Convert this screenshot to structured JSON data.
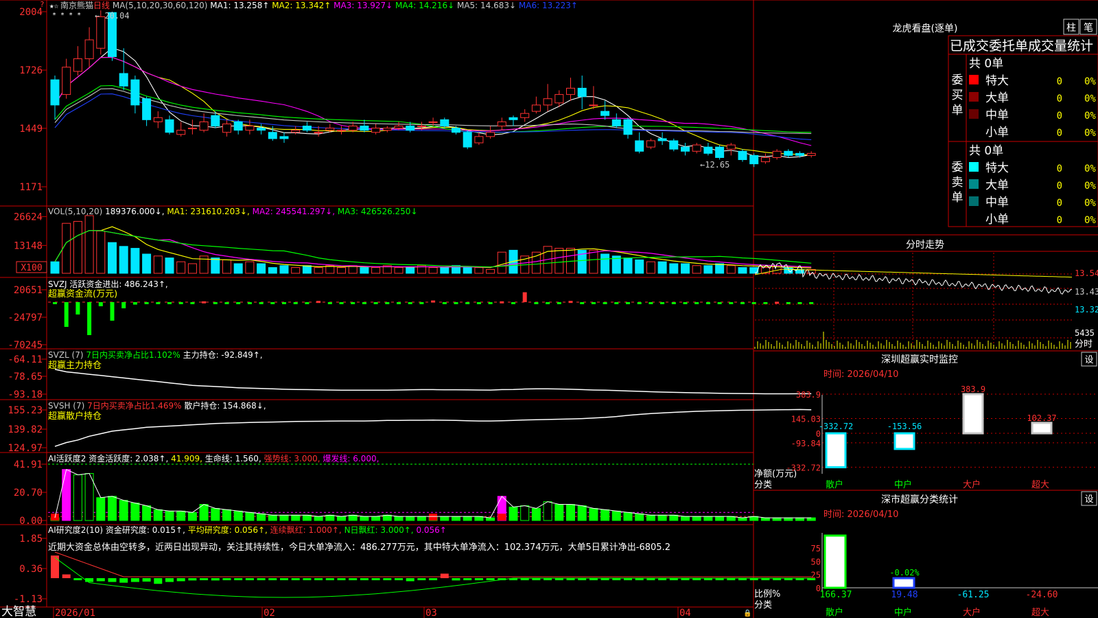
{
  "stock": {
    "name": "南京熊猫",
    "period": "日线"
  },
  "colors": {
    "up": "#ff3232",
    "down": "#00e6ff",
    "grid": "#c80000",
    "volGreen": "#00ff00"
  },
  "main": {
    "legend_prefix": "MA(5,10,20,30,60,120)",
    "ma": [
      {
        "label": "MA1:",
        "value": "13.258",
        "arrow": "↑",
        "color": "#ffffff"
      },
      {
        "label": "MA2:",
        "value": "13.342",
        "arrow": "↑",
        "color": "#ffff00"
      },
      {
        "label": "MA3:",
        "value": "13.927",
        "arrow": "↓",
        "color": "#ff00ff"
      },
      {
        "label": "MA4:",
        "value": "14.216",
        "arrow": "↓",
        "color": "#00ff00"
      },
      {
        "label": "MA5:",
        "value": "14.683",
        "arrow": "↓",
        "color": "#c8c8c8"
      },
      {
        "label": "MA6:",
        "value": "13.223",
        "arrow": "↑",
        "color": "#2040ff"
      }
    ],
    "yticks": [
      "2004",
      "1726",
      "1449",
      "1171"
    ],
    "high_note": "20.04",
    "low_note": "12.65"
  },
  "vol": {
    "legend": [
      {
        "text": "VOL(5,10,20) ",
        "color": "#c8c8c8"
      },
      {
        "text": "189376.000↓, ",
        "color": "#ffffff"
      },
      {
        "text": "MA1: 231610.203↓, ",
        "color": "#ffff00"
      },
      {
        "text": "MA2: 245541.297↓, ",
        "color": "#ff00ff"
      },
      {
        "text": "MA3: 426526.250↓",
        "color": "#00ff00"
      }
    ],
    "yticks": [
      "26624",
      "13148"
    ],
    "unit": "X100"
  },
  "svzj": {
    "legend": [
      {
        "text": "SVZJ  活跃资金进出: 486.243↑,",
        "color": "#ffffff"
      }
    ],
    "sub": "超赢资金流(万元)",
    "yticks": [
      "20651",
      "-24797",
      "-70245"
    ]
  },
  "svzl": {
    "legend": [
      {
        "text": "SVZL (7) ",
        "color": "#c8c8c8"
      },
      {
        "text": "7日内买卖净占比1.102% ",
        "color": "#00ff00"
      },
      {
        "text": "主力持仓: -92.849↑,",
        "color": "#ffffff"
      }
    ],
    "sub": "超赢主力持仓",
    "yticks": [
      "-64.11",
      "-78.65",
      "-93.18"
    ]
  },
  "svsh": {
    "legend": [
      {
        "text": "SVSH (7) ",
        "color": "#c8c8c8"
      },
      {
        "text": "7日内买卖净占比1.469% ",
        "color": "#ff3232"
      },
      {
        "text": "散户持仓: 154.868↓,",
        "color": "#ffffff"
      }
    ],
    "sub": "超赢散户持仓",
    "yticks": [
      "155.23",
      "139.82",
      "124.97"
    ]
  },
  "ai1": {
    "legend": [
      {
        "text": "AI活跃度2 ",
        "color": "#ffffff"
      },
      {
        "text": "资金活跃度: 2.038↑, ",
        "color": "#ffffff"
      },
      {
        "text": "41.909, ",
        "color": "#ffff00"
      },
      {
        "text": "生命线: 1.560, ",
        "color": "#ffffff"
      },
      {
        "text": "强势线: 3.000, ",
        "color": "#ff3232"
      },
      {
        "text": "爆发线: 6.000,",
        "color": "#ff00ff"
      }
    ],
    "yticks": [
      "41.91",
      "20.70",
      "0.00"
    ]
  },
  "ai2": {
    "legend": [
      {
        "text": "AI研究度2(10) ",
        "color": "#ffffff"
      },
      {
        "text": "资金研究度: 0.015↑, ",
        "color": "#ffffff"
      },
      {
        "text": "平均研究度: 0.056↑, ",
        "color": "#ffff00"
      },
      {
        "text": "连续飘红: 1.000↑, ",
        "color": "#ff3232"
      },
      {
        "text": "N日飘红: 3.000↑, ",
        "color": "#00ff00"
      },
      {
        "text": "0.056↑",
        "color": "#ff00ff"
      }
    ],
    "note": "近期大资金总体由空转多，近两日出现异动，关注其持续性，今日大单净流入：486.277万元，其中特大单净流入：102.374万元，大单5日累计净出-6805.2",
    "yticks": [
      "1.85",
      "0.36",
      "-1.13"
    ]
  },
  "xaxis": {
    "labels": [
      "2026/01",
      "02",
      "03",
      "04"
    ]
  },
  "brand": "大智慧",
  "right": {
    "title": "龙虎看盘(逐单)",
    "btn1": "柱",
    "btn2": "笔",
    "table_title": "已成交委托单成交量统计",
    "buy": {
      "label": "委买单",
      "total": "共 0单",
      "rows": [
        {
          "name": "特大",
          "count": "0",
          "pct": "0%",
          "color": "#ff0000"
        },
        {
          "name": "大单",
          "count": "0",
          "pct": "0%",
          "color": "#8b0000"
        },
        {
          "name": "中单",
          "count": "0",
          "pct": "0%",
          "color": "#6a0000"
        },
        {
          "name": "小单",
          "count": "0",
          "pct": "0%",
          "color": ""
        }
      ]
    },
    "sell": {
      "label": "委卖单",
      "total": "共 0单",
      "rows": [
        {
          "name": "特大",
          "count": "0",
          "pct": "0%",
          "color": "#00ffff"
        },
        {
          "name": "大单",
          "count": "0",
          "pct": "0%",
          "color": "#008b8b"
        },
        {
          "name": "中单",
          "count": "0",
          "pct": "0%",
          "color": "#007070"
        },
        {
          "name": "小单",
          "count": "0",
          "pct": "0%",
          "color": ""
        }
      ]
    },
    "minute": {
      "title": "分时走势",
      "yticks": [
        "13.54",
        "13.43",
        "13.32",
        "5435"
      ],
      "vol_label": "分时"
    },
    "monitor": {
      "title": "深圳超赢实时监控",
      "set": "设",
      "time": "时间: 2026/04/10",
      "yticks": [
        "383.9",
        "145.03",
        "0",
        "-93.84",
        "-332.72"
      ],
      "ylabel": "净额(万元)",
      "xlabel": "分类",
      "cats": [
        "散户",
        "中户",
        "大户",
        "超大"
      ]
    },
    "classify": {
      "title": "深市超赢分类统计",
      "set": "设",
      "time": "时间: 2026/04/10",
      "yticks": [
        "75",
        "50",
        "25",
        "0"
      ],
      "ylabel": "比例%",
      "xlabel": "分类",
      "cats": [
        "散户",
        "中户",
        "大户",
        "超大"
      ]
    }
  },
  "chart_data": [
    {
      "type": "candlestick",
      "title": "南京熊猫 日线",
      "ylim": [
        11.71,
        20.04
      ],
      "candles": [
        [
          16.8,
          15.6,
          17.0,
          14.9
        ],
        [
          16.1,
          17.4,
          17.8,
          15.9
        ],
        [
          17.2,
          17.8,
          18.4,
          17.0
        ],
        [
          17.8,
          18.7,
          19.3,
          17.4
        ],
        [
          18.3,
          19.8,
          20.1,
          18.0
        ],
        [
          20.0,
          17.9,
          20.04,
          17.7
        ],
        [
          17.1,
          16.5,
          18.3,
          16.3
        ],
        [
          16.8,
          15.6,
          17.0,
          15.2
        ],
        [
          15.9,
          14.9,
          16.0,
          14.6
        ],
        [
          14.8,
          15.0,
          15.3,
          14.5
        ],
        [
          14.9,
          14.3,
          15.1,
          14.2
        ],
        [
          14.2,
          14.4,
          14.8,
          14.1
        ],
        [
          14.5,
          14.5,
          14.9,
          14.2
        ],
        [
          14.4,
          14.8,
          15.2,
          14.3
        ],
        [
          15.1,
          14.6,
          15.3,
          14.5
        ],
        [
          14.3,
          14.7,
          14.9,
          14.1
        ],
        [
          14.8,
          14.4,
          14.9,
          14.2
        ],
        [
          14.4,
          14.6,
          14.9,
          14.2
        ],
        [
          14.5,
          14.4,
          14.7,
          14.2
        ],
        [
          14.3,
          14.0,
          14.6,
          13.9
        ],
        [
          14.1,
          14.0,
          14.3,
          13.8
        ],
        [
          14.3,
          14.4,
          14.6,
          14.2
        ],
        [
          14.6,
          14.4,
          14.8,
          14.3
        ],
        [
          14.3,
          14.3,
          14.6,
          14.1
        ],
        [
          14.4,
          14.5,
          14.7,
          14.3
        ],
        [
          14.4,
          14.4,
          14.6,
          14.2
        ],
        [
          14.4,
          14.6,
          14.8,
          14.3
        ],
        [
          14.6,
          14.4,
          14.9,
          14.3
        ],
        [
          14.3,
          14.5,
          14.7,
          14.2
        ],
        [
          14.4,
          14.5,
          14.6,
          14.3
        ],
        [
          14.5,
          14.6,
          14.8,
          14.4
        ],
        [
          14.6,
          14.4,
          14.8,
          14.3
        ],
        [
          14.6,
          14.6,
          14.8,
          14.4
        ],
        [
          14.8,
          14.8,
          15.0,
          14.6
        ],
        [
          14.9,
          14.6,
          15.0,
          14.5
        ],
        [
          14.5,
          14.3,
          14.6,
          14.2
        ],
        [
          14.3,
          13.6,
          14.4,
          13.5
        ],
        [
          13.8,
          14.1,
          14.3,
          13.7
        ],
        [
          14.1,
          14.3,
          14.6,
          14.0
        ],
        [
          14.6,
          14.8,
          15.0,
          14.4
        ],
        [
          15.0,
          14.9,
          15.1,
          14.6
        ],
        [
          15.0,
          15.2,
          15.4,
          14.8
        ],
        [
          15.3,
          15.6,
          16.0,
          15.2
        ],
        [
          15.6,
          15.9,
          16.6,
          15.3
        ],
        [
          15.7,
          16.1,
          16.3,
          15.5
        ],
        [
          16.1,
          16.4,
          16.9,
          15.8
        ],
        [
          16.4,
          16.0,
          17.0,
          15.4
        ],
        [
          15.6,
          15.6,
          16.5,
          15.4
        ],
        [
          15.3,
          15.1,
          15.8,
          14.9
        ],
        [
          14.9,
          14.6,
          15.2,
          14.5
        ],
        [
          14.9,
          14.2,
          15.0,
          14.0
        ],
        [
          13.9,
          13.4,
          14.3,
          13.3
        ],
        [
          13.6,
          13.9,
          14.0,
          13.5
        ],
        [
          14.0,
          13.9,
          14.3,
          13.7
        ],
        [
          13.9,
          13.5,
          14.0,
          13.4
        ],
        [
          13.6,
          13.4,
          13.8,
          13.2
        ],
        [
          13.4,
          13.7,
          13.8,
          13.3
        ],
        [
          13.6,
          13.3,
          13.8,
          13.2
        ],
        [
          13.6,
          13.1,
          13.7,
          13.0
        ],
        [
          13.5,
          13.7,
          13.8,
          13.2
        ],
        [
          13.4,
          13.0,
          13.5,
          12.9
        ],
        [
          13.2,
          12.8,
          13.3,
          12.65
        ],
        [
          12.9,
          13.1,
          13.3,
          12.8
        ],
        [
          13.1,
          13.4,
          13.5,
          13.0
        ],
        [
          13.4,
          13.2,
          13.5,
          13.1
        ],
        [
          13.3,
          13.2,
          13.4,
          13.1
        ],
        [
          13.2,
          13.3,
          13.4,
          13.1
        ]
      ]
    },
    {
      "type": "bar",
      "title": "VOL",
      "ylim": [
        0,
        26624
      ],
      "values": [
        6,
        26,
        27,
        30,
        22,
        16,
        14,
        13,
        10,
        9,
        8,
        6,
        5,
        9,
        8,
        7,
        5,
        6,
        5,
        3,
        4,
        3,
        4,
        3,
        4,
        3,
        4,
        3,
        3,
        4,
        3,
        3,
        4,
        3,
        3,
        4,
        3,
        3,
        2,
        11,
        12,
        9,
        11,
        14,
        13,
        13,
        12,
        12,
        10,
        9,
        8,
        7,
        6,
        6,
        5,
        5,
        4,
        4,
        5,
        4,
        3,
        3,
        3,
        4,
        3,
        2,
        2
      ]
    },
    {
      "type": "bar",
      "title": "SVZJ",
      "ylim": [
        -70245,
        20651
      ],
      "values": [
        -4,
        -60,
        -30,
        -80,
        -10,
        -45,
        -15,
        -6,
        -3,
        -2,
        -4,
        -3,
        -2,
        2,
        -3,
        -3,
        -2,
        -1,
        -2,
        -3,
        -2,
        -2,
        -2,
        3,
        -2,
        -2,
        -4,
        -2,
        -3,
        -2,
        -2,
        -3,
        -2,
        4,
        -3,
        -2,
        -1,
        -4,
        -2,
        2,
        -2,
        24,
        -2,
        -2,
        -3,
        3,
        -2,
        -2,
        -4,
        -2,
        -3,
        -1,
        -2,
        -1,
        -2,
        -1,
        -2,
        -1,
        -2,
        -1,
        -2,
        -1,
        -2,
        1,
        -1,
        -2,
        -1
      ]
    },
    {
      "type": "line",
      "title": "SVZL 主力持仓",
      "ylim": [
        -93.18,
        -64.11
      ],
      "values": [
        -73,
        -75,
        -76,
        -77,
        -78,
        -79,
        -80,
        -81,
        -82,
        -83,
        -84,
        -85,
        -86,
        -86.5,
        -87,
        -87.5,
        -88,
        -88.3,
        -88.6,
        -88.9,
        -89.2,
        -89.4,
        -89.5,
        -89.6,
        -89.8,
        -90,
        -90,
        -90,
        -90,
        -90,
        -89.8,
        -89.6,
        -89.5,
        -89.5,
        -89.6,
        -89.6,
        -89.7,
        -89.8,
        -89.9,
        -89.5,
        -89.4,
        -89.0,
        -88.8,
        -88.8,
        -89.0,
        -89.2,
        -89.5,
        -89.8,
        -90.0,
        -90.3,
        -90.6,
        -90.9,
        -91.2,
        -91.5,
        -91.7,
        -91.9,
        -92.1,
        -92.3,
        -92.5,
        -92.6,
        -92.7,
        -92.8,
        -92.9,
        -92.9,
        -92.9,
        -92.85,
        -92.849
      ]
    },
    {
      "type": "line",
      "title": "SVSH 散户持仓",
      "ylim": [
        124.97,
        155.23
      ],
      "values": [
        126,
        129,
        131,
        134,
        136,
        138,
        139,
        140,
        141,
        141.5,
        142,
        142.5,
        143,
        143.5,
        144,
        144.3,
        144.6,
        144.8,
        145,
        145.2,
        145.4,
        145.6,
        145.7,
        145.8,
        145.9,
        146,
        146,
        146,
        146.2,
        146.4,
        146.5,
        146.6,
        146.6,
        146.7,
        146.6,
        146.4,
        146.2,
        146,
        146,
        146.2,
        146.5,
        146.8,
        147.0,
        147.2,
        147.4,
        147.6,
        147.9,
        148.3,
        148.8,
        149.5,
        150.4,
        151.2,
        151.8,
        152.3,
        152.8,
        153.2,
        153.6,
        153.9,
        154.1,
        154.3,
        154.5,
        154.6,
        154.7,
        154.8,
        154.9,
        155.0,
        154.868
      ]
    },
    {
      "type": "bar",
      "title": "AI活跃度2",
      "ylim": [
        0,
        41.91
      ],
      "values": [
        2,
        38,
        34,
        35,
        17,
        18,
        15,
        13,
        11,
        8,
        7,
        7,
        6,
        12,
        9,
        8,
        7,
        6,
        5,
        4,
        4,
        4,
        4,
        3,
        4,
        3,
        4,
        3,
        3,
        4,
        3,
        3,
        3,
        3,
        3,
        3,
        3,
        3,
        2,
        18,
        10,
        11,
        9,
        14,
        12,
        12,
        11,
        9,
        8,
        7,
        6,
        5,
        4,
        4,
        4,
        3,
        3,
        3,
        3,
        3,
        2,
        3,
        2,
        2,
        2,
        2,
        2
      ]
    },
    {
      "type": "bar",
      "title": "AI研究度2",
      "ylim": [
        -1.13,
        1.85
      ],
      "values": [
        0.6,
        0.1,
        -0.05,
        -0.1,
        -0.08,
        -0.1,
        -0.12,
        -0.1,
        -0.09,
        -0.15,
        -0.1,
        -0.08,
        -0.06,
        -0.05,
        -0.06,
        -0.05,
        -0.05,
        -0.04,
        -0.05,
        -0.04,
        -0.04,
        -0.04,
        -0.03,
        -0.04,
        -0.03,
        -0.03,
        -0.03,
        -0.05,
        -0.03,
        -0.03,
        -0.04,
        -0.08,
        -0.03,
        -0.03,
        0.12,
        -0.06,
        -0.03,
        -0.04,
        -0.03,
        -0.03,
        -0.03,
        -0.03,
        -0.04,
        -0.03,
        -0.04,
        -0.03,
        -0.03,
        -0.04,
        -0.03,
        -0.05,
        -0.03,
        -0.03,
        -0.04,
        -0.03,
        -0.03,
        -0.02,
        -0.03,
        -0.02,
        -0.03,
        -0.02,
        -0.03,
        -0.02,
        -0.03,
        -0.02,
        -0.02,
        -0.02,
        -0.02
      ]
    },
    {
      "type": "bar",
      "title": "深圳超赢实时监控",
      "categories": [
        "散户",
        "中户",
        "大户",
        "超大"
      ],
      "values": [
        -332.72,
        -153.56,
        383.9,
        102.37
      ],
      "ylim": [
        -332.72,
        383.9
      ]
    },
    {
      "type": "bar",
      "title": "深市超赢分类统计",
      "categories": [
        "散户",
        "中户",
        "大户",
        "超大"
      ],
      "values": [
        166.37,
        19.48,
        -61.25,
        -24.6
      ],
      "pct_labels": [
        "",
        "-0.02%",
        "",
        ""
      ],
      "ylim": [
        0,
        75
      ]
    }
  ]
}
